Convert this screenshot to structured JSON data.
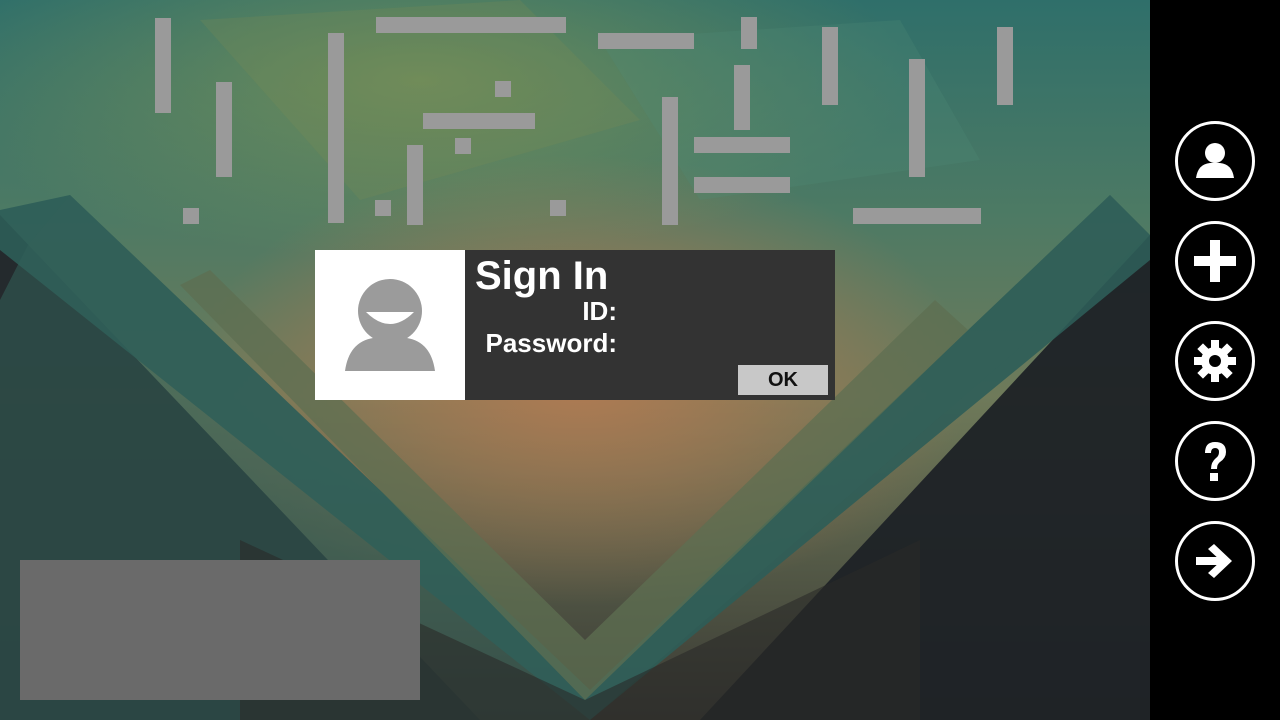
{
  "dialog": {
    "title": "Sign In",
    "id_label": "ID:",
    "password_label": "Password:",
    "id_value": "",
    "password_value": "",
    "ok_label": "OK",
    "avatar_icon": "user-avatar-icon"
  },
  "side_panel": {
    "buttons": [
      {
        "name": "account",
        "icon": "user-icon"
      },
      {
        "name": "add",
        "icon": "plus-icon"
      },
      {
        "name": "settings",
        "icon": "gear-icon"
      },
      {
        "name": "help",
        "icon": "question-icon"
      },
      {
        "name": "next",
        "icon": "arrow-right-icon"
      }
    ]
  },
  "colors": {
    "dialog_bg": "#333333",
    "panel_bg": "#000000",
    "ok_button_bg": "#c8c8c8",
    "info_box_bg": "#6a6a6a",
    "bar_color": "#9a9a9a"
  }
}
